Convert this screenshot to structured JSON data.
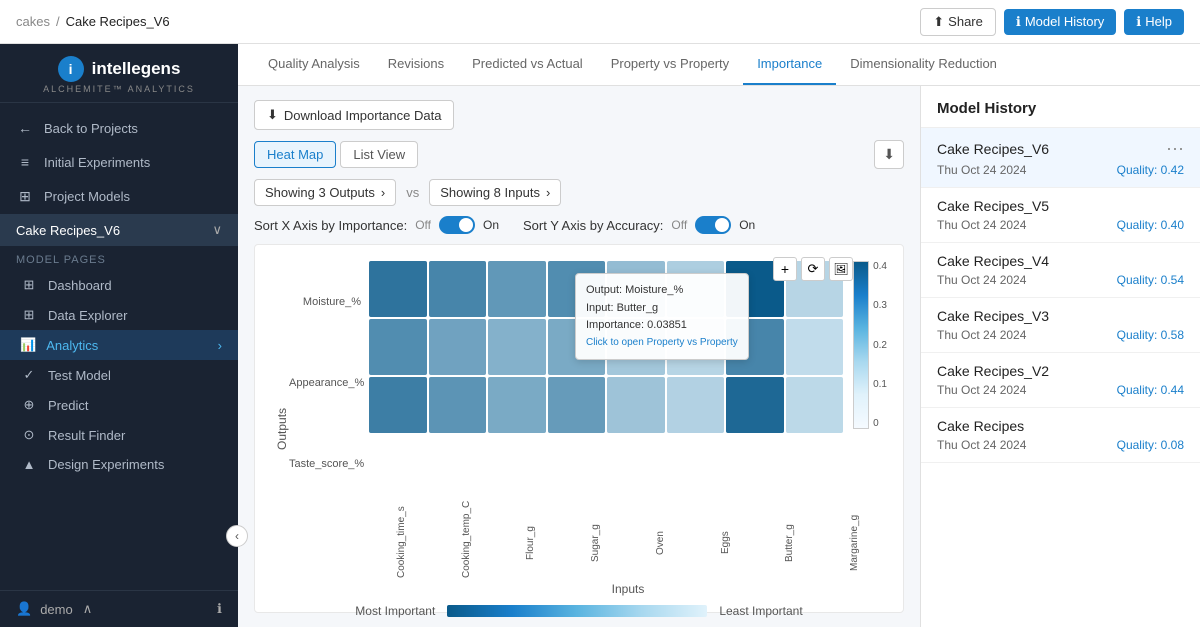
{
  "header": {
    "breadcrumb_folder": "cakes",
    "breadcrumb_sep": "/",
    "breadcrumb_current": "Cake Recipes_V6",
    "share_label": "Share",
    "model_history_label": "Model History",
    "help_label": "Help"
  },
  "sidebar": {
    "logo_letter": "i",
    "logo_name": "intellegens",
    "logo_sub": "ALCHEMITE™ ANALYTICS",
    "nav": [
      {
        "id": "back",
        "icon": "←",
        "label": "Back to Projects"
      },
      {
        "id": "experiments",
        "icon": "≡",
        "label": "Initial Experiments"
      },
      {
        "id": "models",
        "icon": "⊞",
        "label": "Project Models"
      }
    ],
    "project_name": "Cake Recipes_V6",
    "model_pages_label": "Model Pages",
    "sub_nav": [
      {
        "id": "dashboard",
        "icon": "⊞",
        "label": "Dashboard"
      },
      {
        "id": "data-explorer",
        "icon": "⊞",
        "label": "Data Explorer"
      },
      {
        "id": "analytics",
        "icon": "📊",
        "label": "Analytics",
        "active": true,
        "has_arrow": true
      },
      {
        "id": "test-model",
        "icon": "✓",
        "label": "Test Model"
      },
      {
        "id": "predict",
        "icon": "⊕",
        "label": "Predict"
      },
      {
        "id": "result-finder",
        "icon": "⊙",
        "label": "Result Finder"
      },
      {
        "id": "design",
        "icon": "▲",
        "label": "Design Experiments"
      }
    ],
    "user_label": "demo",
    "collapse_icon": "‹"
  },
  "tabs": [
    {
      "id": "quality",
      "label": "Quality Analysis"
    },
    {
      "id": "revisions",
      "label": "Revisions"
    },
    {
      "id": "predicted",
      "label": "Predicted vs Actual"
    },
    {
      "id": "property",
      "label": "Property vs Property"
    },
    {
      "id": "importance",
      "label": "Importance",
      "active": true
    },
    {
      "id": "dimensionality",
      "label": "Dimensionality Reduction"
    }
  ],
  "toolbar": {
    "download_label": "Download Importance Data"
  },
  "view_tabs": [
    {
      "id": "heatmap",
      "label": "Heat Map",
      "active": true
    },
    {
      "id": "listview",
      "label": "List View"
    }
  ],
  "filters": {
    "outputs_label": "Showing 3 Outputs",
    "separator": "vs",
    "inputs_label": "Showing 8 Inputs"
  },
  "sort": {
    "x_label": "Sort X Axis by Importance:",
    "x_off": "Off",
    "x_on": "On",
    "x_state": "on",
    "y_label": "Sort Y Axis by Accuracy:",
    "y_off": "Off",
    "y_on": "On",
    "y_state": "on"
  },
  "heatmap": {
    "y_title": "Outputs",
    "x_title": "Inputs",
    "y_labels": [
      "Moisture_%",
      "Appearance_%",
      "Taste_score_%"
    ],
    "x_labels": [
      "Cooking_time_s",
      "Cooking_temp_C",
      "Flour_g",
      "Sugar_g",
      "Oven",
      "Eggs",
      "Butter_g",
      "Margarine_g"
    ],
    "cells": [
      [
        0.35,
        0.3,
        0.25,
        0.28,
        0.15,
        0.1,
        0.42,
        0.08
      ],
      [
        0.28,
        0.22,
        0.18,
        0.2,
        0.12,
        0.08,
        0.3,
        0.06
      ],
      [
        0.32,
        0.26,
        0.2,
        0.24,
        0.13,
        0.09,
        0.38,
        0.07
      ]
    ],
    "scale_max": "0.4",
    "scale_mid1": "0.3",
    "scale_mid2": "0.2",
    "scale_mid3": "0.1",
    "scale_min": "0",
    "legend_most": "Most Important",
    "legend_least": "Least Important"
  },
  "tooltip": {
    "output_label": "Output:",
    "output_value": "Moisture_%",
    "input_label": "Input:",
    "input_value": "Butter_g",
    "importance_label": "Importance:",
    "importance_value": "0.03851",
    "click_hint": "Click to open Property vs Property"
  },
  "model_history": {
    "title": "Model History",
    "items": [
      {
        "name": "Cake Recipes_V6",
        "date": "Thu Oct 24 2024",
        "quality_label": "Quality:",
        "quality": "0.42",
        "active": true
      },
      {
        "name": "Cake Recipes_V5",
        "date": "Thu Oct 24 2024",
        "quality_label": "Quality:",
        "quality": "0.40",
        "active": false
      },
      {
        "name": "Cake Recipes_V4",
        "date": "Thu Oct 24 2024",
        "quality_label": "Quality:",
        "quality": "0.54",
        "active": false
      },
      {
        "name": "Cake Recipes_V3",
        "date": "Thu Oct 24 2024",
        "quality_label": "Quality:",
        "quality": "0.58",
        "active": false
      },
      {
        "name": "Cake Recipes_V2",
        "date": "Thu Oct 24 2024",
        "quality_label": "Quality:",
        "quality": "0.44",
        "active": false
      },
      {
        "name": "Cake Recipes",
        "date": "Thu Oct 24 2024",
        "quality_label": "Quality:",
        "quality": "0.08",
        "active": false
      }
    ]
  }
}
